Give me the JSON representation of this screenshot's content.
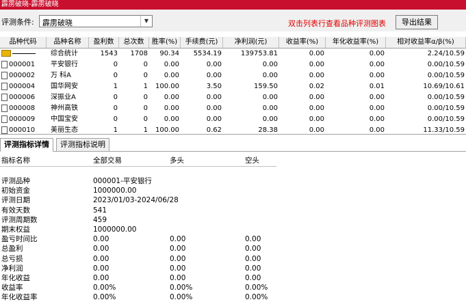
{
  "window": {
    "title": "霹雳破晓-霹雳破晓"
  },
  "toolbar": {
    "condition_label": "评测条件:",
    "condition_value": "霹雳破晓",
    "hint": "双击列表行查看品种评测图表",
    "export_label": "导出结果"
  },
  "table": {
    "columns": [
      "品种代码",
      "品种名称",
      "盈利数",
      "总次数",
      "胜率(%)",
      "手续费(元)",
      "净利润(元)",
      "收益率(%)",
      "年化收益率(%)",
      "相对收益率α/β(%)"
    ],
    "rows": [
      {
        "code": "",
        "name": "综合统计",
        "win": "1543",
        "total": "1708",
        "rate": "90.34",
        "fee": "5534.19",
        "profit": "139753.81",
        "ret": "0.00",
        "annual": "0.00",
        "rel": "2.24/10.59"
      },
      {
        "code": "000001",
        "name": "平安银行",
        "win": "0",
        "total": "0",
        "rate": "0.00",
        "fee": "0.00",
        "profit": "0.00",
        "ret": "0.00",
        "annual": "0.00",
        "rel": "0.00/10.59"
      },
      {
        "code": "000002",
        "name": "万 科A",
        "win": "0",
        "total": "0",
        "rate": "0.00",
        "fee": "0.00",
        "profit": "0.00",
        "ret": "0.00",
        "annual": "0.00",
        "rel": "0.00/10.59"
      },
      {
        "code": "000004",
        "name": "国华网安",
        "win": "1",
        "total": "1",
        "rate": "100.00",
        "fee": "3.50",
        "profit": "159.50",
        "ret": "0.02",
        "annual": "0.01",
        "rel": "10.69/10.61"
      },
      {
        "code": "000006",
        "name": "深振业A",
        "win": "0",
        "total": "0",
        "rate": "0.00",
        "fee": "0.00",
        "profit": "0.00",
        "ret": "0.00",
        "annual": "0.00",
        "rel": "0.00/10.59"
      },
      {
        "code": "000008",
        "name": "神州高铁",
        "win": "0",
        "total": "0",
        "rate": "0.00",
        "fee": "0.00",
        "profit": "0.00",
        "ret": "0.00",
        "annual": "0.00",
        "rel": "0.00/10.59"
      },
      {
        "code": "000009",
        "name": "中国宝安",
        "win": "0",
        "total": "0",
        "rate": "0.00",
        "fee": "0.00",
        "profit": "0.00",
        "ret": "0.00",
        "annual": "0.00",
        "rel": "0.00/10.59"
      },
      {
        "code": "000010",
        "name": "美丽生态",
        "win": "1",
        "total": "1",
        "rate": "100.00",
        "fee": "0.62",
        "profit": "28.38",
        "ret": "0.00",
        "annual": "0.00",
        "rel": "11.33/10.59"
      }
    ]
  },
  "tabs": [
    "评测指标详情",
    "评测指标说明"
  ],
  "detail": {
    "headers": [
      "指标名称",
      "全部交易",
      "多头",
      "空头"
    ],
    "rows": [
      {
        "name": "评测品种",
        "all": "000001-平安银行",
        "long": "",
        "short": ""
      },
      {
        "name": "初始资金",
        "all": "1000000.00",
        "long": "",
        "short": ""
      },
      {
        "name": "评测日期",
        "all": "2023/01/03-2024/06/28",
        "long": "",
        "short": ""
      },
      {
        "name": "有效天数",
        "all": "541",
        "long": "",
        "short": ""
      },
      {
        "name": "评测周期数",
        "all": "459",
        "long": "",
        "short": ""
      },
      {
        "name": "期末权益",
        "all": "1000000.00",
        "long": "",
        "short": ""
      },
      {
        "name": "盈亏时间比",
        "all": "0.00",
        "long": "0.00",
        "short": "0.00"
      },
      {
        "name": "总盈利",
        "all": "0.00",
        "long": "0.00",
        "short": "0.00"
      },
      {
        "name": "总亏损",
        "all": "0.00",
        "long": "0.00",
        "short": "0.00"
      },
      {
        "name": "净利润",
        "all": "0.00",
        "long": "0.00",
        "short": "0.00"
      },
      {
        "name": "年化收益",
        "all": "0.00",
        "long": "0.00",
        "short": "0.00"
      },
      {
        "name": "收益率",
        "all": "0.00%",
        "long": "0.00%",
        "short": "0.00%"
      },
      {
        "name": "年化收益率",
        "all": "0.00%",
        "long": "0.00%",
        "short": "0.00%"
      }
    ]
  }
}
